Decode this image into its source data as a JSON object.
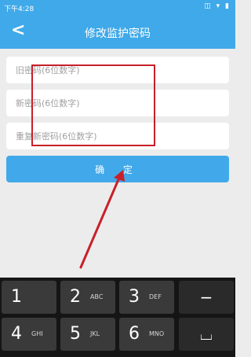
{
  "statusbar": {
    "time": "下午4:28",
    "icons": "◫ ▾ ▮"
  },
  "header": {
    "title": "修改监护密码",
    "back_icon": "<"
  },
  "form": {
    "old_password_placeholder": "旧密码(6位数字)",
    "new_password_placeholder": "新密码(6位数字)",
    "repeat_password_placeholder": "重复新密码(6位数字)",
    "confirm_label": "确 定"
  },
  "keyboard": {
    "keys": [
      {
        "num": "1",
        "letters": ""
      },
      {
        "num": "2",
        "letters": "ABC"
      },
      {
        "num": "3",
        "letters": "DEF"
      },
      {
        "num": "−",
        "letters": ""
      },
      {
        "num": "4",
        "letters": "GHI"
      },
      {
        "num": "5",
        "letters": "JKL"
      },
      {
        "num": "6",
        "letters": "MNO"
      },
      {
        "num": "⌴",
        "letters": ""
      }
    ]
  },
  "colors": {
    "accent": "#3fa9e9",
    "annotation_red": "#c8202a"
  }
}
